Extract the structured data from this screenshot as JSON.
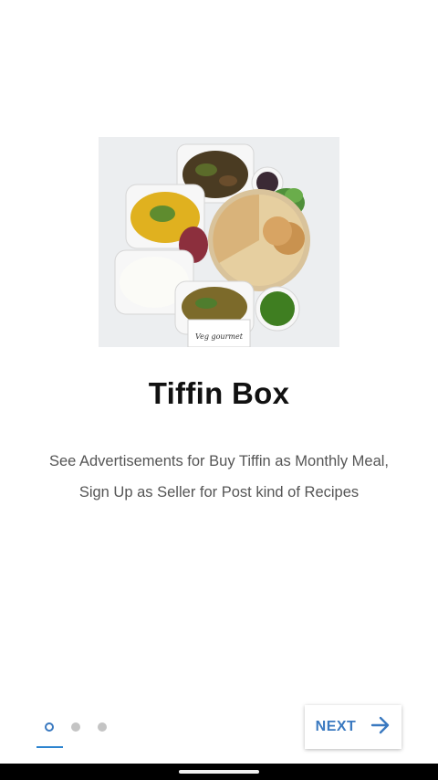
{
  "hero": {
    "image_caption": "Veg gourmet"
  },
  "title": "Tiffin Box",
  "description": {
    "line1": "See Advertisements for Buy Tiffin as Monthly Meal,",
    "line2": "Sign Up as Seller for Post kind of Recipes"
  },
  "pager": {
    "total": 3,
    "current": 1
  },
  "next_button": {
    "label": "NEXT",
    "icon": "arrow-right-icon"
  },
  "colors": {
    "accent": "#3a79c0",
    "indicator": "#2d84cf",
    "title": "#111111",
    "text": "#555555",
    "dot_inactive": "#c4c4c4"
  }
}
